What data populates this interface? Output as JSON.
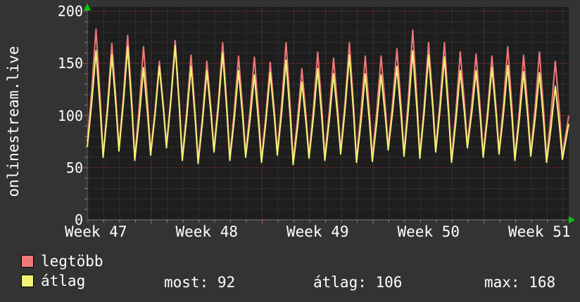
{
  "app": {
    "vertical_title": "onlinestream.live"
  },
  "chart_data": {
    "type": "line",
    "title": "",
    "ylabel": "onlinestream.live",
    "ylim": [
      0,
      200
    ],
    "y_ticks": [
      0,
      50,
      100,
      150,
      200
    ],
    "minor_y_step": 10,
    "x_week_labels": [
      "Week 47",
      "Week 48",
      "Week 49",
      "Week 50",
      "Week 51"
    ],
    "days_per_week": 7,
    "grid": {
      "minor_color": "#4e4e4e",
      "major_color": "#a84848",
      "axis_color": "#7a7a7a",
      "arrow_color": "#00cc00"
    },
    "plot_bg": "#1e1e1e",
    "outer_bg": "#333333",
    "series": [
      {
        "name": "legtöbb",
        "color": "#f07878"
      },
      {
        "name": "átlag",
        "color": "#f2f275"
      }
    ],
    "days": [
      {
        "t": [
          75,
          70
        ],
        "p": [
          183,
          162
        ]
      },
      {
        "t": [
          62,
          60
        ],
        "p": [
          169,
          158
        ]
      },
      {
        "t": [
          70,
          66
        ],
        "p": [
          177,
          166
        ]
      },
      {
        "t": [
          60,
          57
        ],
        "p": [
          166,
          146
        ]
      },
      {
        "t": [
          65,
          62
        ],
        "p": [
          152,
          147
        ]
      },
      {
        "t": [
          72,
          69
        ],
        "p": [
          172,
          167
        ]
      },
      {
        "t": [
          60,
          57
        ],
        "p": [
          158,
          147
        ]
      },
      {
        "t": [
          57,
          54
        ],
        "p": [
          152,
          143
        ]
      },
      {
        "t": [
          68,
          65
        ],
        "p": [
          170,
          160
        ]
      },
      {
        "t": [
          60,
          57
        ],
        "p": [
          157,
          143
        ]
      },
      {
        "t": [
          63,
          60
        ],
        "p": [
          156,
          139
        ]
      },
      {
        "t": [
          58,
          55
        ],
        "p": [
          151,
          141
        ]
      },
      {
        "t": [
          65,
          62
        ],
        "p": [
          170,
          153
        ]
      },
      {
        "t": [
          57,
          53
        ],
        "p": [
          145,
          132
        ]
      },
      {
        "t": [
          62,
          59
        ],
        "p": [
          161,
          145
        ]
      },
      {
        "t": [
          60,
          57
        ],
        "p": [
          155,
          140
        ]
      },
      {
        "t": [
          66,
          63
        ],
        "p": [
          170,
          158
        ]
      },
      {
        "t": [
          58,
          55
        ],
        "p": [
          157,
          140
        ]
      },
      {
        "t": [
          60,
          56
        ],
        "p": [
          157,
          139
        ]
      },
      {
        "t": [
          70,
          67
        ],
        "p": [
          164,
          147
        ]
      },
      {
        "t": [
          64,
          61
        ],
        "p": [
          182,
          162
        ]
      },
      {
        "t": [
          62,
          59
        ],
        "p": [
          170,
          158
        ]
      },
      {
        "t": [
          68,
          65
        ],
        "p": [
          170,
          156
        ]
      },
      {
        "t": [
          58,
          55
        ],
        "p": [
          161,
          143
        ]
      },
      {
        "t": [
          72,
          69
        ],
        "p": [
          159,
          143
        ]
      },
      {
        "t": [
          63,
          60
        ],
        "p": [
          157,
          146
        ]
      },
      {
        "t": [
          66,
          63
        ],
        "p": [
          166,
          148
        ]
      },
      {
        "t": [
          60,
          57
        ],
        "p": [
          158,
          142
        ]
      },
      {
        "t": [
          64,
          61
        ],
        "p": [
          161,
          141
        ]
      },
      {
        "t": [
          58,
          55
        ],
        "p": [
          152,
          128
        ]
      }
    ],
    "tail": {
      "t": [
        62,
        58
      ],
      "end": [
        100,
        92
      ]
    }
  },
  "legend": {
    "items": [
      {
        "label": "legtöbb",
        "color": "#f07878"
      },
      {
        "label": "átlag",
        "color": "#f2f275"
      }
    ],
    "stats": [
      {
        "text": "most: 92"
      },
      {
        "text": "átlag: 106"
      },
      {
        "text": "max: 168"
      }
    ]
  }
}
